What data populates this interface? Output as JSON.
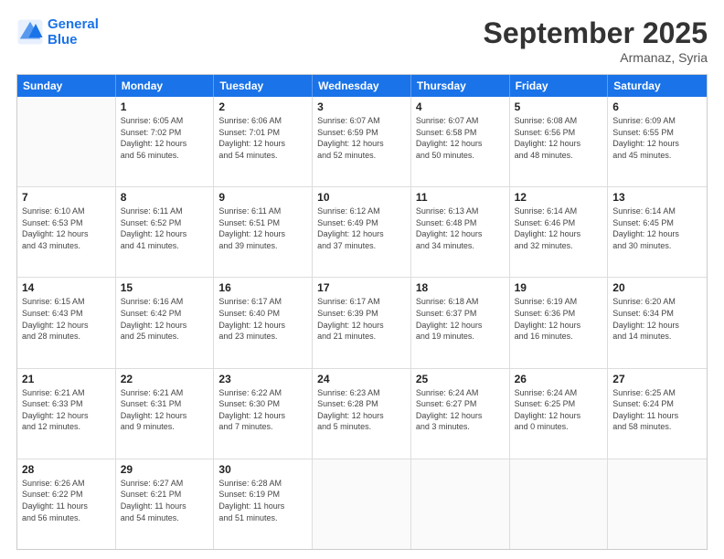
{
  "header": {
    "logo_line1": "General",
    "logo_line2": "Blue",
    "title": "September 2025",
    "subtitle": "Armanaz, Syria"
  },
  "days_of_week": [
    "Sunday",
    "Monday",
    "Tuesday",
    "Wednesday",
    "Thursday",
    "Friday",
    "Saturday"
  ],
  "weeks": [
    [
      {
        "day": "",
        "info": ""
      },
      {
        "day": "1",
        "info": "Sunrise: 6:05 AM\nSunset: 7:02 PM\nDaylight: 12 hours\nand 56 minutes."
      },
      {
        "day": "2",
        "info": "Sunrise: 6:06 AM\nSunset: 7:01 PM\nDaylight: 12 hours\nand 54 minutes."
      },
      {
        "day": "3",
        "info": "Sunrise: 6:07 AM\nSunset: 6:59 PM\nDaylight: 12 hours\nand 52 minutes."
      },
      {
        "day": "4",
        "info": "Sunrise: 6:07 AM\nSunset: 6:58 PM\nDaylight: 12 hours\nand 50 minutes."
      },
      {
        "day": "5",
        "info": "Sunrise: 6:08 AM\nSunset: 6:56 PM\nDaylight: 12 hours\nand 48 minutes."
      },
      {
        "day": "6",
        "info": "Sunrise: 6:09 AM\nSunset: 6:55 PM\nDaylight: 12 hours\nand 45 minutes."
      }
    ],
    [
      {
        "day": "7",
        "info": "Sunrise: 6:10 AM\nSunset: 6:53 PM\nDaylight: 12 hours\nand 43 minutes."
      },
      {
        "day": "8",
        "info": "Sunrise: 6:11 AM\nSunset: 6:52 PM\nDaylight: 12 hours\nand 41 minutes."
      },
      {
        "day": "9",
        "info": "Sunrise: 6:11 AM\nSunset: 6:51 PM\nDaylight: 12 hours\nand 39 minutes."
      },
      {
        "day": "10",
        "info": "Sunrise: 6:12 AM\nSunset: 6:49 PM\nDaylight: 12 hours\nand 37 minutes."
      },
      {
        "day": "11",
        "info": "Sunrise: 6:13 AM\nSunset: 6:48 PM\nDaylight: 12 hours\nand 34 minutes."
      },
      {
        "day": "12",
        "info": "Sunrise: 6:14 AM\nSunset: 6:46 PM\nDaylight: 12 hours\nand 32 minutes."
      },
      {
        "day": "13",
        "info": "Sunrise: 6:14 AM\nSunset: 6:45 PM\nDaylight: 12 hours\nand 30 minutes."
      }
    ],
    [
      {
        "day": "14",
        "info": "Sunrise: 6:15 AM\nSunset: 6:43 PM\nDaylight: 12 hours\nand 28 minutes."
      },
      {
        "day": "15",
        "info": "Sunrise: 6:16 AM\nSunset: 6:42 PM\nDaylight: 12 hours\nand 25 minutes."
      },
      {
        "day": "16",
        "info": "Sunrise: 6:17 AM\nSunset: 6:40 PM\nDaylight: 12 hours\nand 23 minutes."
      },
      {
        "day": "17",
        "info": "Sunrise: 6:17 AM\nSunset: 6:39 PM\nDaylight: 12 hours\nand 21 minutes."
      },
      {
        "day": "18",
        "info": "Sunrise: 6:18 AM\nSunset: 6:37 PM\nDaylight: 12 hours\nand 19 minutes."
      },
      {
        "day": "19",
        "info": "Sunrise: 6:19 AM\nSunset: 6:36 PM\nDaylight: 12 hours\nand 16 minutes."
      },
      {
        "day": "20",
        "info": "Sunrise: 6:20 AM\nSunset: 6:34 PM\nDaylight: 12 hours\nand 14 minutes."
      }
    ],
    [
      {
        "day": "21",
        "info": "Sunrise: 6:21 AM\nSunset: 6:33 PM\nDaylight: 12 hours\nand 12 minutes."
      },
      {
        "day": "22",
        "info": "Sunrise: 6:21 AM\nSunset: 6:31 PM\nDaylight: 12 hours\nand 9 minutes."
      },
      {
        "day": "23",
        "info": "Sunrise: 6:22 AM\nSunset: 6:30 PM\nDaylight: 12 hours\nand 7 minutes."
      },
      {
        "day": "24",
        "info": "Sunrise: 6:23 AM\nSunset: 6:28 PM\nDaylight: 12 hours\nand 5 minutes."
      },
      {
        "day": "25",
        "info": "Sunrise: 6:24 AM\nSunset: 6:27 PM\nDaylight: 12 hours\nand 3 minutes."
      },
      {
        "day": "26",
        "info": "Sunrise: 6:24 AM\nSunset: 6:25 PM\nDaylight: 12 hours\nand 0 minutes."
      },
      {
        "day": "27",
        "info": "Sunrise: 6:25 AM\nSunset: 6:24 PM\nDaylight: 11 hours\nand 58 minutes."
      }
    ],
    [
      {
        "day": "28",
        "info": "Sunrise: 6:26 AM\nSunset: 6:22 PM\nDaylight: 11 hours\nand 56 minutes."
      },
      {
        "day": "29",
        "info": "Sunrise: 6:27 AM\nSunset: 6:21 PM\nDaylight: 11 hours\nand 54 minutes."
      },
      {
        "day": "30",
        "info": "Sunrise: 6:28 AM\nSunset: 6:19 PM\nDaylight: 11 hours\nand 51 minutes."
      },
      {
        "day": "",
        "info": ""
      },
      {
        "day": "",
        "info": ""
      },
      {
        "day": "",
        "info": ""
      },
      {
        "day": "",
        "info": ""
      }
    ]
  ]
}
